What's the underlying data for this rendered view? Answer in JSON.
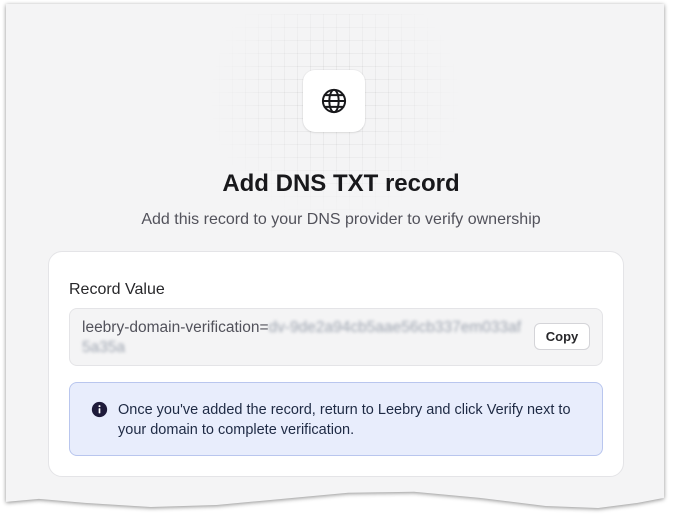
{
  "header": {
    "title": "Add DNS TXT record",
    "subtitle": "Add this record to your DNS provider to verify ownership",
    "icon": "globe-icon"
  },
  "record": {
    "label": "Record Value",
    "value_prefix": "leebry-domain-verification=",
    "value_secret": "dv-9de2a94cb5aae56cb337em033af5a35a",
    "copy_label": "Copy"
  },
  "info": {
    "icon": "info-icon",
    "text": "Once you've added the record, return to Leebry and click Verify next to your domain to complete verification.",
    "accent": "#e8edfc"
  }
}
